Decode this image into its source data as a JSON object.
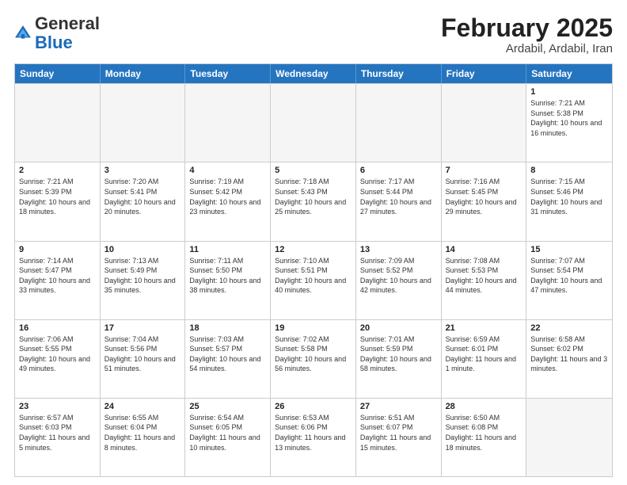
{
  "header": {
    "logo_general": "General",
    "logo_blue": "Blue",
    "title": "February 2025",
    "location": "Ardabil, Ardabil, Iran"
  },
  "days_of_week": [
    "Sunday",
    "Monday",
    "Tuesday",
    "Wednesday",
    "Thursday",
    "Friday",
    "Saturday"
  ],
  "weeks": [
    [
      {
        "day": "",
        "info": ""
      },
      {
        "day": "",
        "info": ""
      },
      {
        "day": "",
        "info": ""
      },
      {
        "day": "",
        "info": ""
      },
      {
        "day": "",
        "info": ""
      },
      {
        "day": "",
        "info": ""
      },
      {
        "day": "1",
        "info": "Sunrise: 7:21 AM\nSunset: 5:38 PM\nDaylight: 10 hours and 16 minutes."
      }
    ],
    [
      {
        "day": "2",
        "info": "Sunrise: 7:21 AM\nSunset: 5:39 PM\nDaylight: 10 hours and 18 minutes."
      },
      {
        "day": "3",
        "info": "Sunrise: 7:20 AM\nSunset: 5:41 PM\nDaylight: 10 hours and 20 minutes."
      },
      {
        "day": "4",
        "info": "Sunrise: 7:19 AM\nSunset: 5:42 PM\nDaylight: 10 hours and 23 minutes."
      },
      {
        "day": "5",
        "info": "Sunrise: 7:18 AM\nSunset: 5:43 PM\nDaylight: 10 hours and 25 minutes."
      },
      {
        "day": "6",
        "info": "Sunrise: 7:17 AM\nSunset: 5:44 PM\nDaylight: 10 hours and 27 minutes."
      },
      {
        "day": "7",
        "info": "Sunrise: 7:16 AM\nSunset: 5:45 PM\nDaylight: 10 hours and 29 minutes."
      },
      {
        "day": "8",
        "info": "Sunrise: 7:15 AM\nSunset: 5:46 PM\nDaylight: 10 hours and 31 minutes."
      }
    ],
    [
      {
        "day": "9",
        "info": "Sunrise: 7:14 AM\nSunset: 5:47 PM\nDaylight: 10 hours and 33 minutes."
      },
      {
        "day": "10",
        "info": "Sunrise: 7:13 AM\nSunset: 5:49 PM\nDaylight: 10 hours and 35 minutes."
      },
      {
        "day": "11",
        "info": "Sunrise: 7:11 AM\nSunset: 5:50 PM\nDaylight: 10 hours and 38 minutes."
      },
      {
        "day": "12",
        "info": "Sunrise: 7:10 AM\nSunset: 5:51 PM\nDaylight: 10 hours and 40 minutes."
      },
      {
        "day": "13",
        "info": "Sunrise: 7:09 AM\nSunset: 5:52 PM\nDaylight: 10 hours and 42 minutes."
      },
      {
        "day": "14",
        "info": "Sunrise: 7:08 AM\nSunset: 5:53 PM\nDaylight: 10 hours and 44 minutes."
      },
      {
        "day": "15",
        "info": "Sunrise: 7:07 AM\nSunset: 5:54 PM\nDaylight: 10 hours and 47 minutes."
      }
    ],
    [
      {
        "day": "16",
        "info": "Sunrise: 7:06 AM\nSunset: 5:55 PM\nDaylight: 10 hours and 49 minutes."
      },
      {
        "day": "17",
        "info": "Sunrise: 7:04 AM\nSunset: 5:56 PM\nDaylight: 10 hours and 51 minutes."
      },
      {
        "day": "18",
        "info": "Sunrise: 7:03 AM\nSunset: 5:57 PM\nDaylight: 10 hours and 54 minutes."
      },
      {
        "day": "19",
        "info": "Sunrise: 7:02 AM\nSunset: 5:58 PM\nDaylight: 10 hours and 56 minutes."
      },
      {
        "day": "20",
        "info": "Sunrise: 7:01 AM\nSunset: 5:59 PM\nDaylight: 10 hours and 58 minutes."
      },
      {
        "day": "21",
        "info": "Sunrise: 6:59 AM\nSunset: 6:01 PM\nDaylight: 11 hours and 1 minute."
      },
      {
        "day": "22",
        "info": "Sunrise: 6:58 AM\nSunset: 6:02 PM\nDaylight: 11 hours and 3 minutes."
      }
    ],
    [
      {
        "day": "23",
        "info": "Sunrise: 6:57 AM\nSunset: 6:03 PM\nDaylight: 11 hours and 5 minutes."
      },
      {
        "day": "24",
        "info": "Sunrise: 6:55 AM\nSunset: 6:04 PM\nDaylight: 11 hours and 8 minutes."
      },
      {
        "day": "25",
        "info": "Sunrise: 6:54 AM\nSunset: 6:05 PM\nDaylight: 11 hours and 10 minutes."
      },
      {
        "day": "26",
        "info": "Sunrise: 6:53 AM\nSunset: 6:06 PM\nDaylight: 11 hours and 13 minutes."
      },
      {
        "day": "27",
        "info": "Sunrise: 6:51 AM\nSunset: 6:07 PM\nDaylight: 11 hours and 15 minutes."
      },
      {
        "day": "28",
        "info": "Sunrise: 6:50 AM\nSunset: 6:08 PM\nDaylight: 11 hours and 18 minutes."
      },
      {
        "day": "",
        "info": ""
      }
    ]
  ]
}
